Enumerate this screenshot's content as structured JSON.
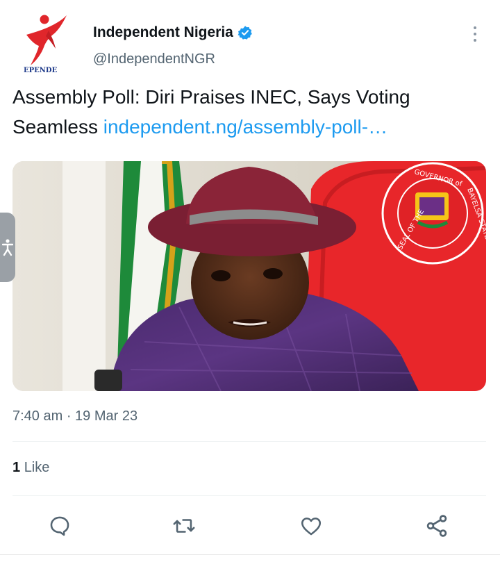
{
  "account": {
    "display_name": "Independent Nigeria",
    "handle": "@IndependentNGR",
    "logo_text": "EPENDE",
    "verified": true
  },
  "tweet": {
    "text": "Assembly Poll: Diri Praises INEC, Says Voting Seamless",
    "link_text": "independent.ng/assembly-poll-…",
    "timestamp": "7:40 am · 19 Mar 23"
  },
  "media": {
    "seal_text_left": "SEAL OF THE",
    "seal_text_top": "GOVERNOR of",
    "seal_text_right": "BAYELSA STATE"
  },
  "stats": {
    "like_count": "1",
    "like_label": "Like"
  },
  "icons": {
    "more": "more-vertical-icon",
    "verified": "verified-badge-icon",
    "reply": "reply-icon",
    "retweet": "retweet-icon",
    "like": "heart-icon",
    "share": "share-icon",
    "accessibility": "accessibility-icon"
  },
  "colors": {
    "link": "#1d9bf0",
    "verified": "#1d9bf0",
    "secondary_text": "#536471",
    "brand_red": "#e0262b"
  }
}
